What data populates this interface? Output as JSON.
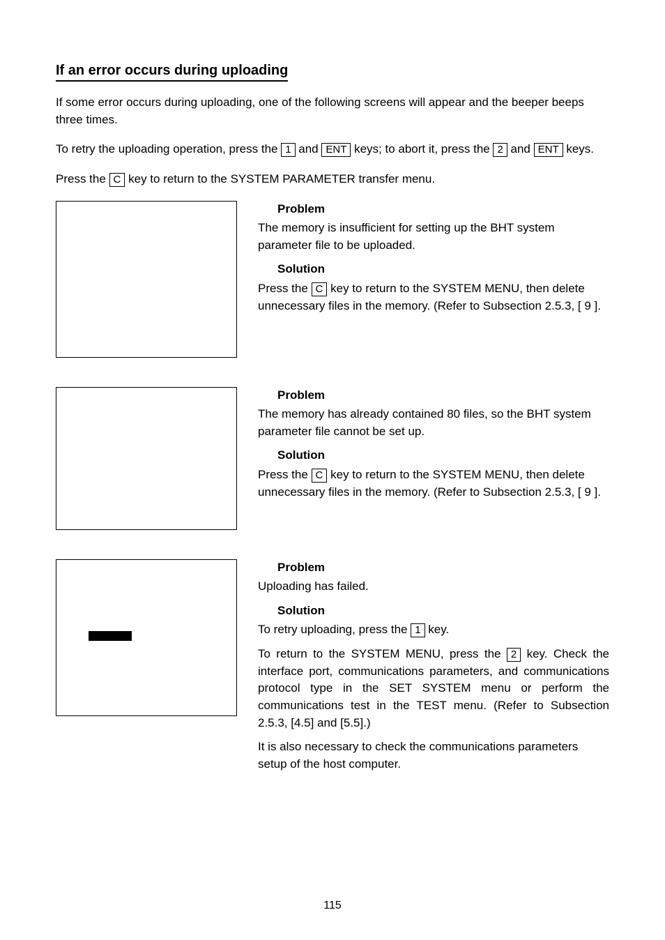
{
  "heading": "If an error occurs during uploading",
  "intro": "If some error occurs during uploading, one of the following screens will appear and the beeper beeps three times.",
  "retry_a": "To retry the uploading operation, press the ",
  "retry_b": " and ",
  "retry_c": " keys; to abort it, press the ",
  "retry_d": " and ",
  "retry_e": " keys.",
  "press_c_a": "Press the ",
  "press_c_b": " key to return to the SYSTEM PARAMETER transfer menu.",
  "keys": {
    "one": "1",
    "two": "2",
    "ent": "ENT",
    "c": "C"
  },
  "labels": {
    "problem": "Problem",
    "solution": "Solution"
  },
  "block1": {
    "problem": "The memory is insufficient for setting up the BHT system parameter file to be uploaded.",
    "sol_a": "Press the ",
    "sol_b": " key to return to the SYSTEM MENU, then delete unnecessary files in the memory.  (Refer to Subsection 2.5.3, [ 9 ]."
  },
  "block2": {
    "problem": "The memory has already contained 80 files, so the BHT system parameter file cannot be set up.",
    "sol_a": "Press the ",
    "sol_b": " key to return to the SYSTEM MENU, then delete unnecessary files in the memory.  (Refer to Subsection 2.5.3, [ 9 ]."
  },
  "block3": {
    "problem": "Uploading has failed.",
    "sol_a": "To retry uploading, press the ",
    "sol_b": " key.",
    "p2_a": "To return to the SYSTEM MENU, press the ",
    "p2_b": " key. Check the interface port, communications parameters, and communications protocol type in the SET SYSTEM menu or perform the communications test in the TEST menu.  (Refer to Subsection 2.5.3, [4.5] and [5.5].)",
    "p3": "It is also necessary to check the communications parameters setup of the host computer."
  },
  "page_number": "115"
}
